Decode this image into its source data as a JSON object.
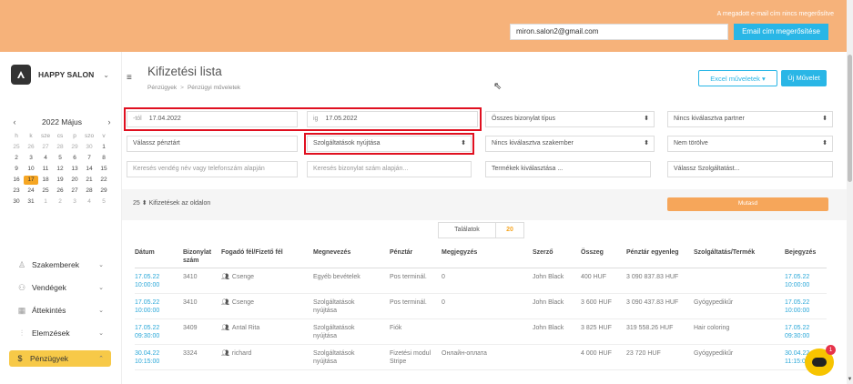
{
  "topbar": {
    "notice": "A megadott e-mail cím nincs megerősítve",
    "email": "miron.salon2@gmail.com",
    "verify_label": "Email cím megerősítése"
  },
  "brand": {
    "name": "HAPPY SALON"
  },
  "calendar": {
    "month_label": "2022 Május",
    "weekdays": [
      "h",
      "k",
      "sze",
      "cs",
      "p",
      "szo",
      "v"
    ],
    "days": [
      [
        "25",
        "26",
        "27",
        "28",
        "29",
        "30",
        "1"
      ],
      [
        "2",
        "3",
        "4",
        "5",
        "6",
        "7",
        "8"
      ],
      [
        "9",
        "10",
        "11",
        "12",
        "13",
        "14",
        "15"
      ],
      [
        "16",
        "17",
        "18",
        "19",
        "20",
        "21",
        "22"
      ],
      [
        "23",
        "24",
        "25",
        "26",
        "27",
        "28",
        "29"
      ],
      [
        "30",
        "31",
        "1",
        "2",
        "3",
        "4",
        "5"
      ]
    ],
    "today": "17"
  },
  "menu": [
    {
      "label": "Szakemberek",
      "icon": "person-icon"
    },
    {
      "label": "Vendégek",
      "icon": "people-icon"
    },
    {
      "label": "Áttekintés",
      "icon": "grid-icon"
    },
    {
      "label": "Elemzések",
      "icon": "chart-icon"
    },
    {
      "label": "Pénzügyek",
      "icon": "money-icon",
      "active": true
    }
  ],
  "header": {
    "title": "Kifizetési lista",
    "breadcrumb": [
      "Pénzügyek",
      "Pénzügyi műveletek"
    ],
    "excel_label": "Excel műveletek",
    "new_label": "Új Művelet"
  },
  "filters": {
    "from_label": "-tól",
    "from_value": "17.04.2022",
    "to_label": "ig",
    "to_value": "17.05.2022",
    "doc_type": "Összes bizonylat típus",
    "partner": "Nincs kiválasztva partner",
    "cashbox": "Válassz pénztárt",
    "service_receipt": "Szolgáltatások nyújtása",
    "specialist": "Nincs kiválasztva szakember",
    "deleted": "Nem törölve",
    "search_guest": "Keresés vendég név vagy telefonszám alapján",
    "search_receipt": "Keresés bizonylat szám alapján...",
    "products": "Termékek kiválasztása ...",
    "services": "Válassz Szolgáltatást...",
    "per_page_value": "25",
    "per_page_label": "Kifizetések az oldalon",
    "show_label": "Mutasd"
  },
  "results": {
    "label": "Találatok",
    "count": "20"
  },
  "table": {
    "headers": [
      "Dátum",
      "Bizonylat szám",
      "Fogadó fél/Fizető fél",
      "Megnevezés",
      "Pénztár",
      "Megjegyzés",
      "Szerző",
      "Összeg",
      "Pénztár egyenleg",
      "Szolgáltatás/Termék",
      "Bejegyzés"
    ],
    "rows": [
      [
        "17.05.22 10:00:00",
        "3410",
        "Csenge",
        "Egyéb bevételek",
        "Pos terminál.",
        "0",
        "John Black",
        "400 HUF",
        "3 090 837.83 HUF",
        "",
        "17.05.22 10:00:00"
      ],
      [
        "17.05.22 10:00:00",
        "3410",
        "Csenge",
        "Szolgáltatások nyújtása",
        "Pos terminál.",
        "0",
        "John Black",
        "3 600 HUF",
        "3 090 437.83 HUF",
        "Gyógypedikűr",
        "17.05.22 10:00:00"
      ],
      [
        "17.05.22 09:30:00",
        "3409",
        "Antal Rita",
        "Szolgáltatások nyújtása",
        "Fiók",
        "",
        "John Black",
        "3 825 HUF",
        "319 558.26 HUF",
        "Hair coloring",
        "17.05.22 09:30:00"
      ],
      [
        "30.04.22 10:15:00",
        "3324",
        "richard",
        "Szolgáltatások nyújtása",
        "Fizetési modul Stripe",
        "Онлайн-оплата",
        "",
        "4 000 HUF",
        "23 720 HUF",
        "Gyógypedikűr",
        "30.04.22 11:15:00"
      ]
    ]
  },
  "chat": {
    "badge": "1"
  }
}
